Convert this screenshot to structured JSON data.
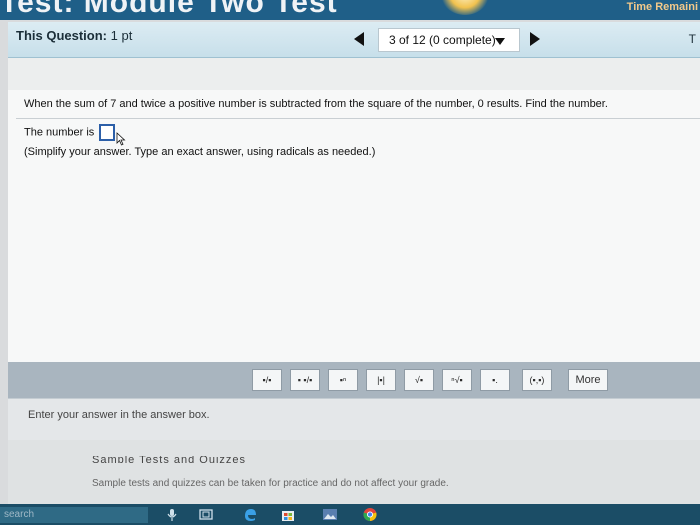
{
  "header": {
    "title": "Test: Module Two Test",
    "time_label": "Time Remaini"
  },
  "question_bar": {
    "label": "This Question:",
    "points": "1 pt",
    "progress": "3 of 12 (0 complete)",
    "right_letter": "T"
  },
  "question": {
    "text": "When the sum of 7 and twice a positive number is subtracted from the square of the number, 0 results.  Find the number.",
    "answer_prefix": "The number is",
    "answer_value": "",
    "hint": "(Simplify your answer.  Type an exact answer, using radicals as needed.)"
  },
  "toolbar": {
    "buttons": [
      "▪/▪",
      "▪ ▪/▪",
      "▪ⁿ",
      "|▪|",
      "√▪",
      "ⁿ√▪",
      "▪.",
      "(▪,▪)"
    ],
    "more_label": "More"
  },
  "status": {
    "text": "Enter your answer in the answer box."
  },
  "footer": {
    "heading": "Sample Tests and Quizzes",
    "note": "Sample tests and quizzes can be taken for practice and do not affect your grade."
  },
  "taskbar": {
    "search": "search"
  },
  "colors": {
    "header": "#1f5f88",
    "question_bar": "#cfe4ee",
    "answer_box": "#2c5fa8",
    "toolbar": "#a9b5bf",
    "taskbar": "#1b4d66"
  }
}
